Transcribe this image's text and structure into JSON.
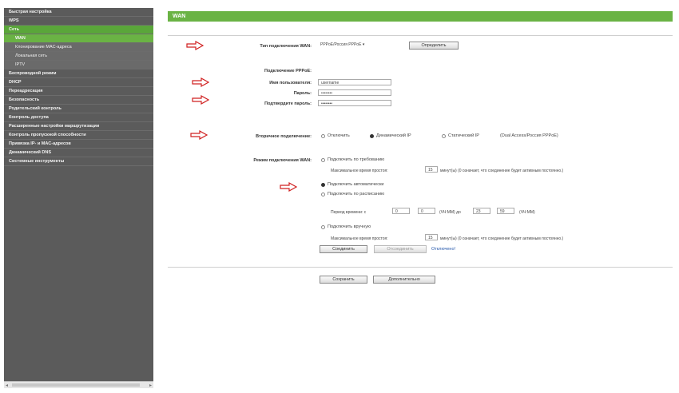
{
  "sidebar": {
    "items": [
      {
        "label": "Быстрая настройка"
      },
      {
        "label": "WPS"
      },
      {
        "label": "Сеть"
      },
      {
        "label": "WAN"
      },
      {
        "label": "Клонирование MAC-адреса"
      },
      {
        "label": "Локальная сеть"
      },
      {
        "label": "IPTV"
      },
      {
        "label": "Беспроводной режим"
      },
      {
        "label": "DHCP"
      },
      {
        "label": "Переадресация"
      },
      {
        "label": "Безопасность"
      },
      {
        "label": "Родительский контроль"
      },
      {
        "label": "Контроль доступа"
      },
      {
        "label": "Расширенные настройки маршрутизации"
      },
      {
        "label": "Контроль пропускной способности"
      },
      {
        "label": "Привязка IP- и MAC-адресов"
      },
      {
        "label": "Динамический DNS"
      },
      {
        "label": "Системные инструменты"
      }
    ],
    "scroll_left": "◂",
    "scroll_right": "▸"
  },
  "header": {
    "title": "WAN"
  },
  "form": {
    "wan_type_label": "Тип подключения WAN:",
    "wan_type_value": "PPPoE/Россия PPPoE",
    "detect_button": "Определить",
    "pppoe_heading": "Подключение PPPoE:",
    "username_label": "Имя пользователя:",
    "username_value": "username",
    "password_label": "Пароль:",
    "password_value": "••••••••",
    "confirm_label": "Подтвердите пароль:",
    "confirm_value": "••••••••",
    "secondary_label": "Вторичное подключение:",
    "secondary_options": [
      "Отключить",
      "Динамический IP",
      "Статический IP"
    ],
    "secondary_note": "(Dual Access/Россия PPPoE)",
    "mode_label": "Режим подключения WAN:",
    "on_demand": "Подключить по требованию",
    "idle_label_1": "Максимальное время простоя:",
    "idle_value_1": "15",
    "idle_note_1": "минут(ы) (0 означает, что соединение будет активным постоянно.)",
    "auto": "Подключить автоматически",
    "scheduled": "Подключить по расписанию",
    "period_label": "Период времени: с",
    "period_from_h": "0",
    "period_from_m": "0",
    "period_to_label": "(ЧЧ:ММ) до",
    "period_to_h": "23",
    "period_to_m": "59",
    "period_unit": "(ЧЧ:ММ)",
    "manual": "Подключить вручную",
    "idle_label_2": "Максимальное время простоя:",
    "idle_value_2": "15",
    "idle_note_2": "минут(ы) (0 означает, что соединение будет активным постоянно.)",
    "connect_button": "Соединить",
    "disconnect_button": "Отсоединить",
    "status_text": "Отключено!"
  },
  "footer": {
    "save_button": "Сохранить",
    "advanced_button": "Дополнительно"
  },
  "colors": {
    "accent": "#6ab344",
    "sidebar_bg": "#5b5b5b",
    "arrow": "#d02020"
  }
}
